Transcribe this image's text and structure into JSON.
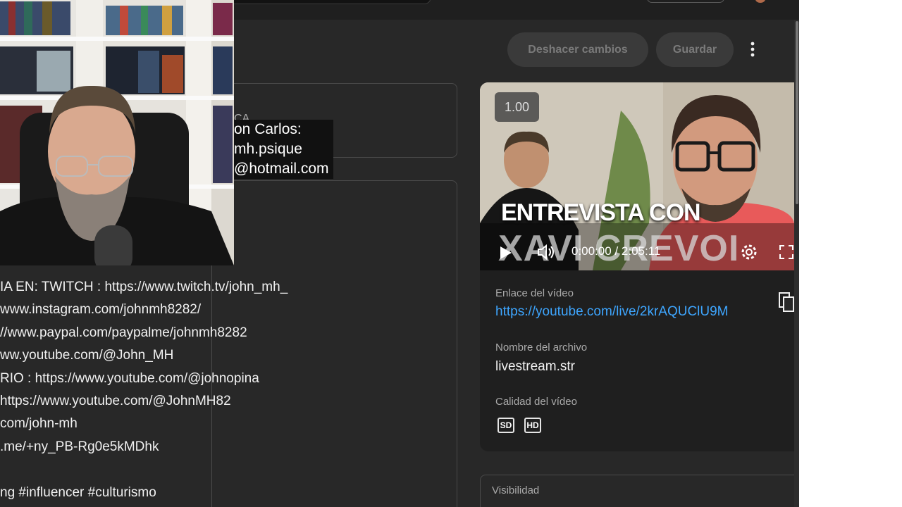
{
  "toolbar": {
    "undo_label": "Deshacer cambios",
    "save_label": "Guardar"
  },
  "overlay": {
    "ca_label": "CA",
    "lines": [
      "on Carlos:",
      "mh.psique",
      "@hotmail.com"
    ]
  },
  "description": {
    "lines": [
      "IA EN: TWITCH : https://www.twitch.tv/john_mh_",
      "www.instagram.com/johnmh8282/",
      "//www.paypal.com/paypalme/johnmh8282",
      "ww.youtube.com/@John_MH",
      "RIO : https://www.youtube.com/@johnopina",
      "https://www.youtube.com/@JohnMH82",
      "com/john-mh",
      ".me/+ny_PB-Rg0e5kMDhk",
      "",
      "ng #influencer #culturismo"
    ]
  },
  "video": {
    "speed": "1.00",
    "thumbnail_text_1": "ENTREVISTA CON",
    "thumbnail_text_2": "XAVI CREVOI",
    "timecode": "0:00:00 / 2:05:11",
    "link_label": "Enlace del vídeo",
    "link_url": "https://youtube.com/live/2krAQUClU9M",
    "filename_label": "Nombre del archivo",
    "filename": "livestream.str",
    "quality_label": "Calidad del vídeo",
    "quality_sd": "SD",
    "quality_hd": "HD"
  },
  "visibility": {
    "label": "Visibilidad"
  },
  "colors": {
    "background": "#282828",
    "link": "#3ea6ff",
    "button_disabled_bg": "#3a3a3a",
    "button_disabled_text": "#7a7a7a"
  }
}
